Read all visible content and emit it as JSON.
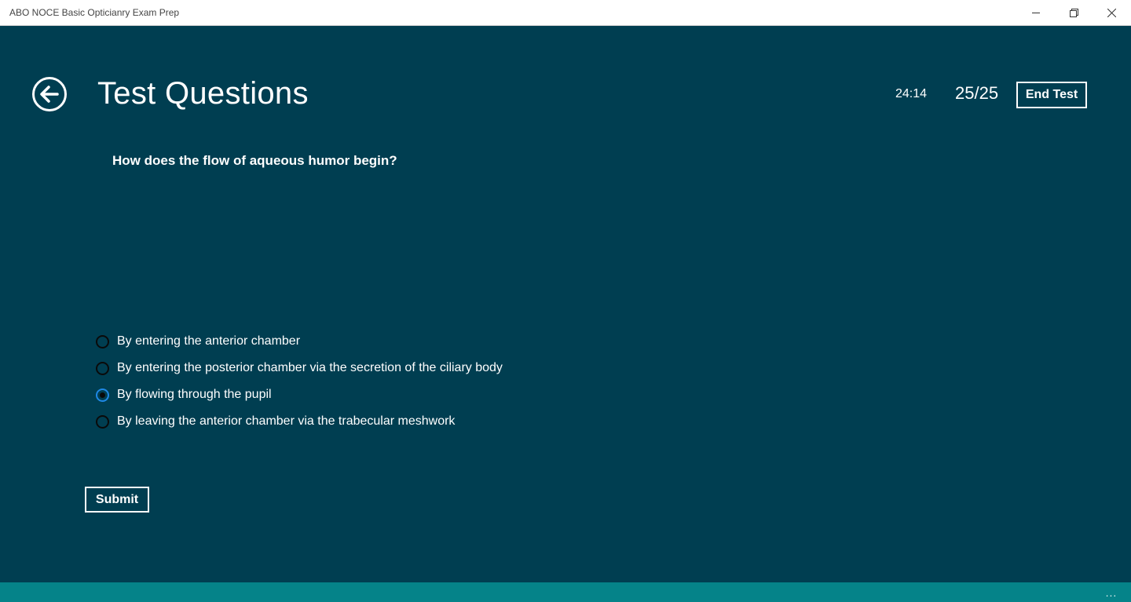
{
  "window": {
    "title": "ABO NOCE Basic Opticianry Exam Prep",
    "minimize_icon": "minimize-icon",
    "maximize_icon": "restore-icon",
    "close_icon": "close-icon"
  },
  "header": {
    "back_icon": "back-arrow-icon",
    "page_title": "Test Questions",
    "timer": "24:14",
    "progress": "25/25",
    "end_test_label": "End Test"
  },
  "question": {
    "text": "How does the flow of aqueous humor begin?",
    "options": [
      {
        "label": "By entering the anterior chamber",
        "selected": false
      },
      {
        "label": "By entering the posterior chamber via the secretion of the ciliary body",
        "selected": false
      },
      {
        "label": "By flowing through the pupil",
        "selected": true
      },
      {
        "label": "By leaving the anterior chamber via the trabecular meshwork",
        "selected": false
      }
    ]
  },
  "actions": {
    "submit_label": "Submit"
  },
  "appbar": {
    "more_label": "...",
    "more_icon": "ellipsis-icon"
  },
  "colors": {
    "background": "#003e51",
    "appbar": "#058389",
    "selected_radio_border": "#1e88e5",
    "text": "#ffffff"
  }
}
